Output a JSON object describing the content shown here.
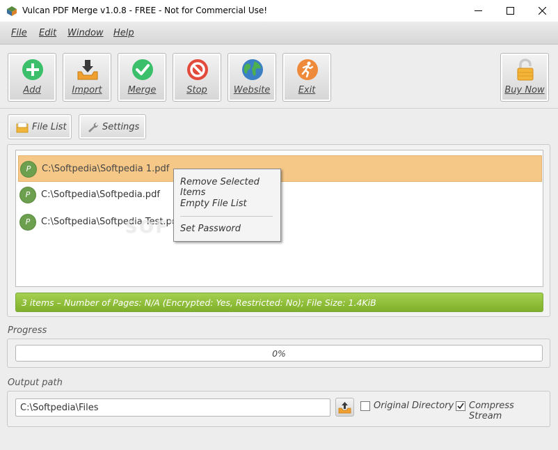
{
  "window": {
    "title": "Vulcan PDF Merge v1.0.8 - FREE - Not for Commercial Use!"
  },
  "menu": [
    {
      "label": "File"
    },
    {
      "label": "Edit"
    },
    {
      "label": "Window"
    },
    {
      "label": "Help"
    }
  ],
  "toolbar": {
    "add_label": "Add",
    "import_label": "Import",
    "merge_label": "Merge",
    "stop_label": "Stop",
    "website_label": "Website",
    "exit_label": "Exit",
    "buy_label": "Buy Now"
  },
  "tabs": {
    "file_list_label": "File List",
    "settings_label": "Settings"
  },
  "files": [
    {
      "path": "C:\\Softpedia\\Softpedia 1.pdf",
      "selected": true
    },
    {
      "path": "C:\\Softpedia\\Softpedia.pdf",
      "selected": false
    },
    {
      "path": "C:\\Softpedia\\Softpedia Test.pdf",
      "selected": false
    }
  ],
  "file_icon_letter": "P",
  "status": {
    "summary": "3 items – Number of Pages: N/A (Encrypted: Yes, Restricted: No); File Size: 1.4KiB"
  },
  "progress": {
    "label": "Progress",
    "percent": 0,
    "text": "0%"
  },
  "output": {
    "label": "Output path",
    "path": "C:\\Softpedia\\Files",
    "original_directory_label": "Original Directory",
    "original_directory_checked": false,
    "compress_stream_label": "Compress Stream",
    "compress_stream_checked": true
  },
  "context_menu": {
    "remove_label": "Remove Selected Items",
    "empty_label": "Empty File List",
    "password_label": "Set Password"
  },
  "watermark": "SOFTPEDIA",
  "colors": {
    "selection": "#f5c888",
    "status_green": "#8dc43a"
  }
}
